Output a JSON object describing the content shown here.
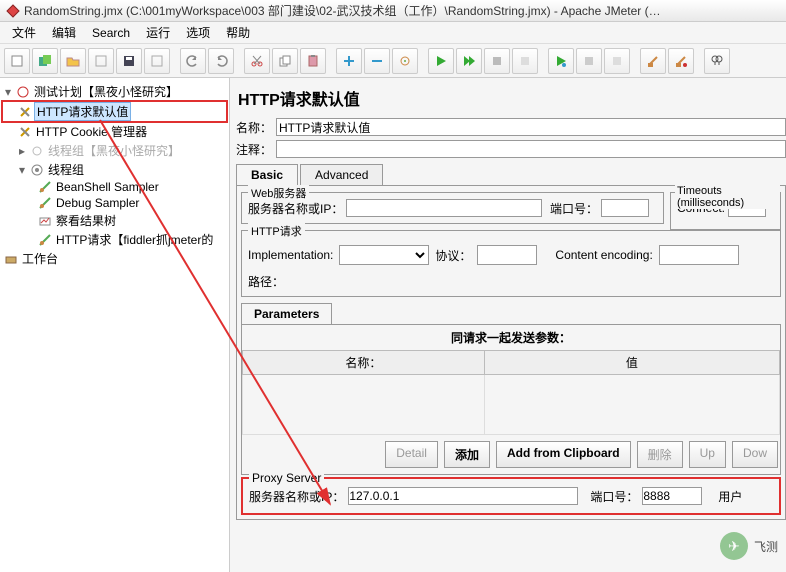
{
  "window": {
    "title": "RandomString.jmx (C:\\001myWorkspace\\003 部门建设\\02-武汉技术组（工作）\\RandomString.jmx) - Apache JMeter (…"
  },
  "menu": {
    "file": "文件",
    "edit": "编辑",
    "search": "Search",
    "run": "运行",
    "options": "选项",
    "help": "帮助"
  },
  "tree": {
    "root": "测试计划【黑夜小怪研究】",
    "n1": "HTTP请求默认值",
    "n2": "HTTP Cookie 管理器",
    "n3": "线程组【黑夜小怪研究】",
    "n4": "线程组",
    "n5": "BeanShell Sampler",
    "n6": "Debug Sampler",
    "n7": "察看结果树",
    "n8": "HTTP请求【fiddler抓jmeter的",
    "workbench": "工作台"
  },
  "panel": {
    "title": "HTTP请求默认值",
    "name_label": "名称：",
    "name_value": "HTTP请求默认值",
    "comment_label": "注释：",
    "comment_value": "",
    "tab_basic": "Basic",
    "tab_advanced": "Advanced",
    "web_legend": "Web服务器",
    "server_label": "服务器名称或IP：",
    "server_value": "",
    "port_label": "端口号：",
    "port_value": "",
    "timeouts_legend": "Timeouts (milliseconds)",
    "connect_label": "Connect:",
    "connect_value": "",
    "http_legend": "HTTP请求",
    "impl_label": "Implementation:",
    "impl_value": "",
    "proto_label": "协议：",
    "proto_value": "",
    "enc_label": "Content encoding:",
    "enc_value": "",
    "path_label": "路径：",
    "ptab": "Parameters",
    "params_title": "同请求一起发送参数：",
    "col_name": "名称：",
    "col_value": "值",
    "btn_detail": "Detail",
    "btn_add": "添加",
    "btn_clip": "Add from Clipboard",
    "btn_del": "删除",
    "btn_up": "Up",
    "btn_down": "Dow",
    "proxy_legend": "Proxy Server",
    "proxy_host_label": "服务器名称或IP：",
    "proxy_host": "127.0.0.1",
    "proxy_port_label": "端口号：",
    "proxy_port": "8888",
    "proxy_user_label": "用户"
  },
  "watermark": "飞测"
}
